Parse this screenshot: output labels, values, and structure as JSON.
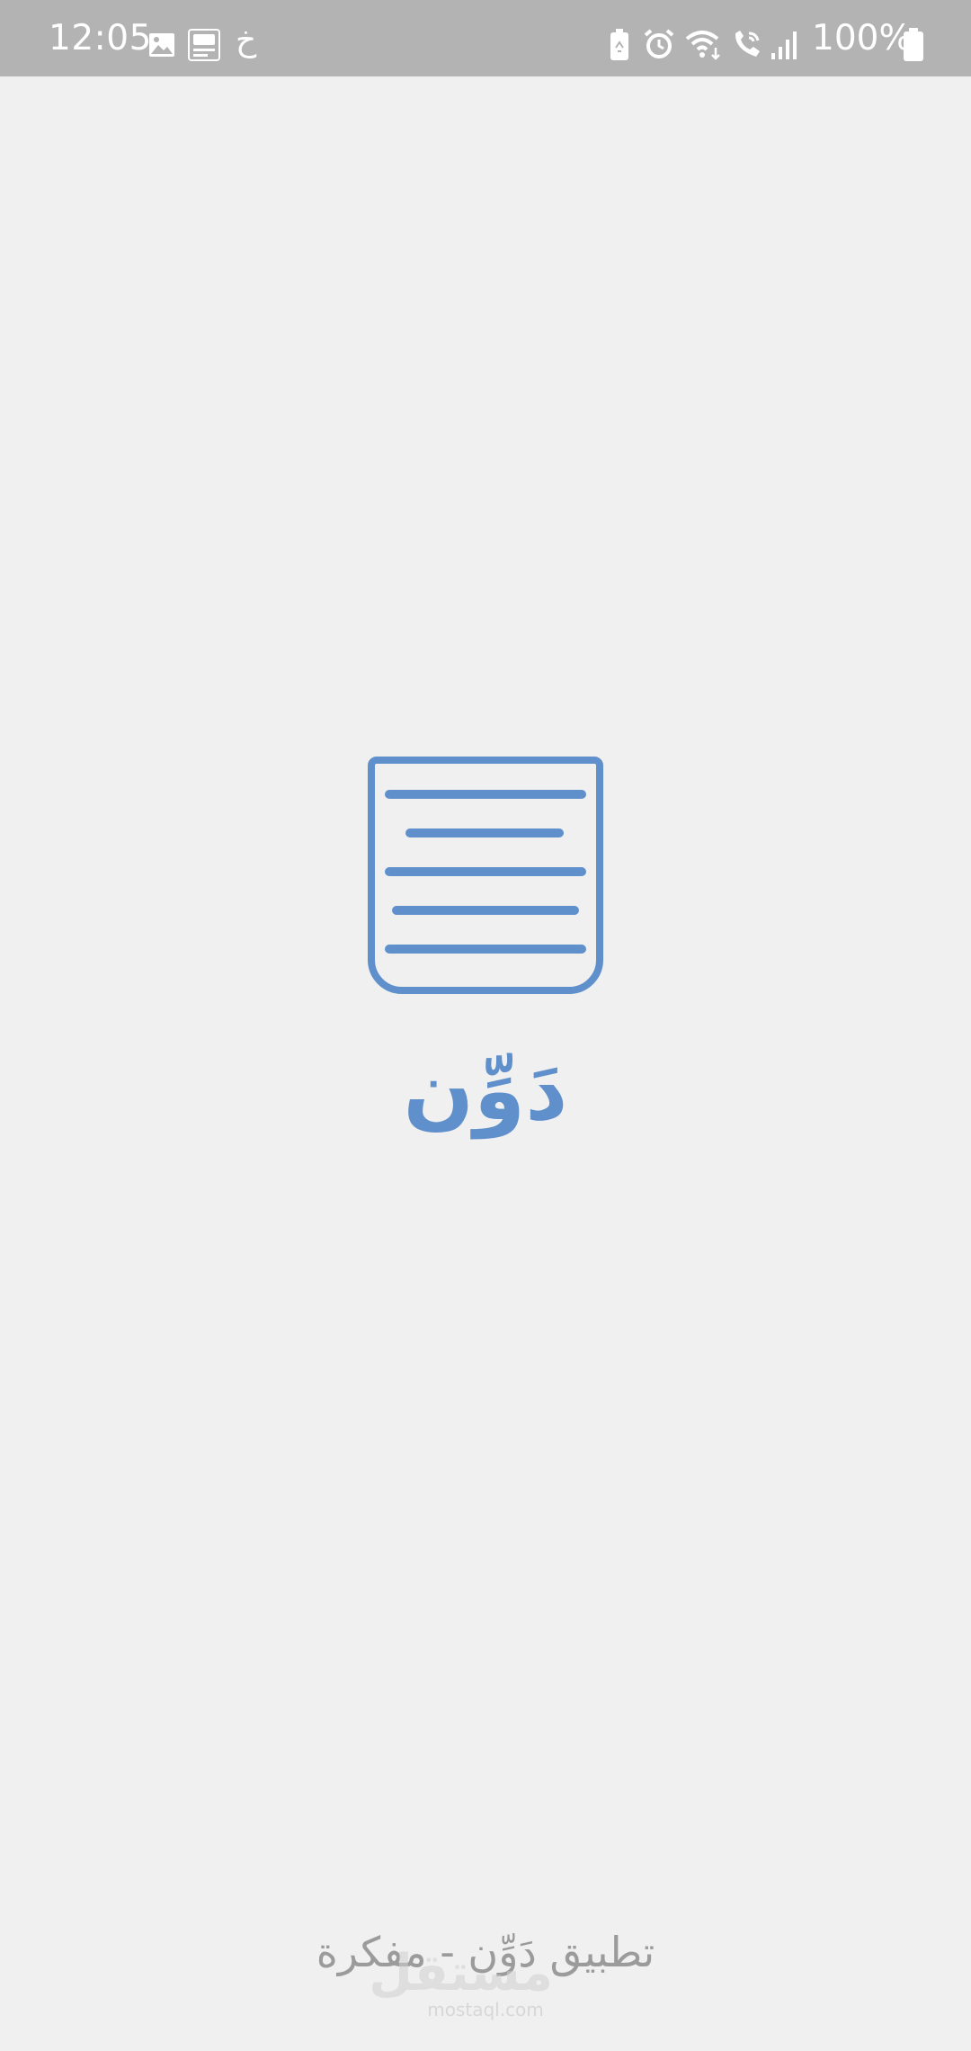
{
  "status_bar": {
    "time": "12:05",
    "left_icons": [
      "image-icon",
      "app-notification-icon"
    ],
    "notification_letter": "خ",
    "right_icons": [
      "battery-saver-icon",
      "alarm-icon",
      "wifi-icon",
      "wifi-call-icon",
      "signal-icon",
      "battery-icon"
    ],
    "battery_percent": "100%"
  },
  "splash": {
    "logo_icon": "notepad-icon",
    "app_name": "دَوِّن",
    "tagline": "تطبيق دَوِّن - مفكرة",
    "accent_color": "#6090cb"
  },
  "watermark": {
    "mark": "مستقل",
    "site": "mostaql.com"
  }
}
